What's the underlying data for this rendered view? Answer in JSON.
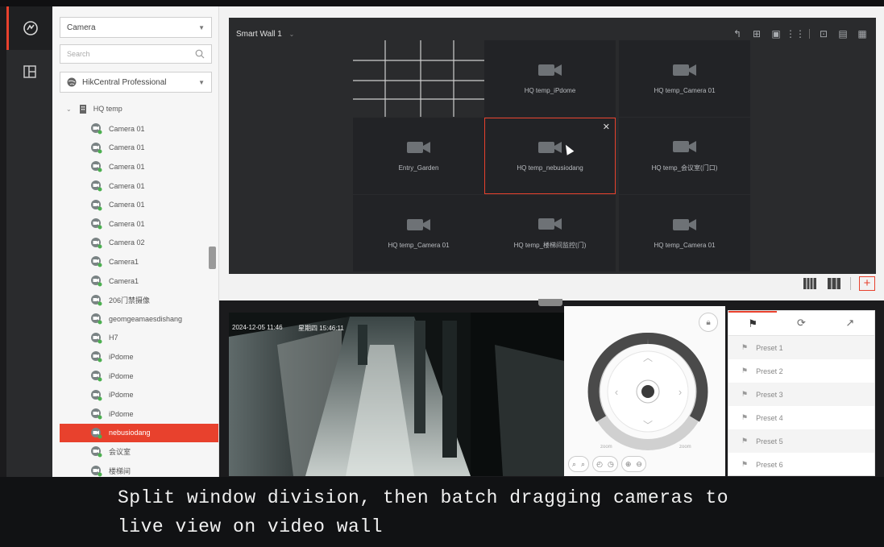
{
  "nav": {
    "items": [
      {
        "icon": "smart-wall-icon",
        "active": true
      },
      {
        "icon": "layout-icon",
        "active": false
      }
    ]
  },
  "tree": {
    "resource_type": "Camera",
    "search_placeholder": "Search",
    "site": "HikCentral Professional",
    "root": "HQ temp",
    "items": [
      "Camera 01",
      "Camera 01",
      "Camera 01",
      "Camera 01",
      "Camera 01",
      "Camera 01",
      "Camera 02",
      "Camera1",
      "Camera1",
      "206门禁摄像",
      "geomgeamaesdishang",
      "H7",
      "iPdome",
      "iPdome",
      "iPdome",
      "iPdome",
      "nebusiodang",
      "会议室",
      "楼梯间"
    ],
    "selected_index": 16
  },
  "wall": {
    "title": "Smart Wall 1",
    "screens": [
      {
        "label": "HQ temp_iPdome"
      },
      {
        "label": "HQ temp_Camera 01"
      },
      {
        "label": "Entry_Garden"
      },
      {
        "label": "HQ temp_nebusiodang"
      },
      {
        "label": "HQ temp_会议室(门口)"
      },
      {
        "label": "HQ temp_Camera 01"
      },
      {
        "label": "HQ temp_楼梯间监控(门)"
      },
      {
        "label": "HQ temp_Camera 01"
      }
    ]
  },
  "live": {
    "osd_date": "2024-12-05 11:46",
    "osd_text": "星期四 15:46:11"
  },
  "ptz": {
    "zoom_out_label": "zoom",
    "zoom_in_label": "zoom"
  },
  "presets": {
    "items": [
      "Preset 1",
      "Preset 2",
      "Preset 3",
      "Preset 4",
      "Preset 5",
      "Preset 6"
    ]
  },
  "caption": {
    "line1": "Split window division, then batch dragging cameras to",
    "line2": "live view on video wall"
  },
  "colors": {
    "accent": "#e8412d",
    "wall_bg": "#2a2b2d"
  }
}
